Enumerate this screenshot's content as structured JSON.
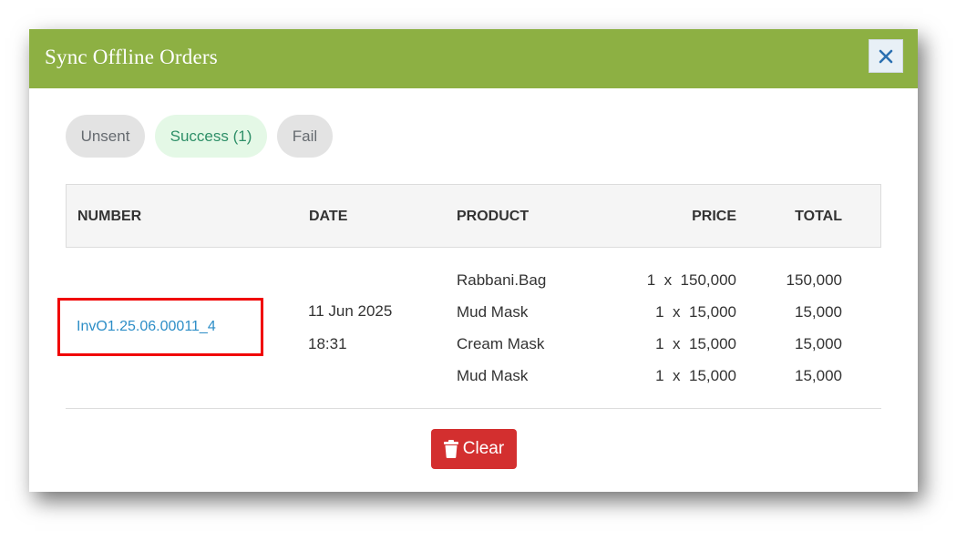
{
  "modal": {
    "title": "Sync Offline Orders",
    "close_label": "×"
  },
  "tabs": [
    {
      "label": "Unsent"
    },
    {
      "label": "Success (1)"
    },
    {
      "label": "Fail"
    }
  ],
  "table": {
    "headers": {
      "number": "NUMBER",
      "date": "DATE",
      "product": "PRODUCT",
      "price": "PRICE",
      "total": "TOTAL"
    },
    "order": {
      "number": "InvO1.25.06.00011_4",
      "date": "11 Jun 2025",
      "time": "18:31",
      "items": [
        {
          "product": "Rabbani.Bag",
          "price": "1  x  150,000",
          "total": "150,000"
        },
        {
          "product": "Mud Mask",
          "price": "1  x  15,000",
          "total": "15,000"
        },
        {
          "product": "Cream Mask",
          "price": "1  x  15,000",
          "total": "15,000"
        },
        {
          "product": "Mud Mask",
          "price": "1  x  15,000",
          "total": "15,000"
        }
      ]
    }
  },
  "actions": {
    "clear_label": "Clear"
  },
  "colors": {
    "header_bg": "#8db043",
    "link": "#2d8ec7",
    "clear_button": "#d32f2f",
    "highlight": "#f00000",
    "success_tab_bg": "#e4f8e6"
  }
}
